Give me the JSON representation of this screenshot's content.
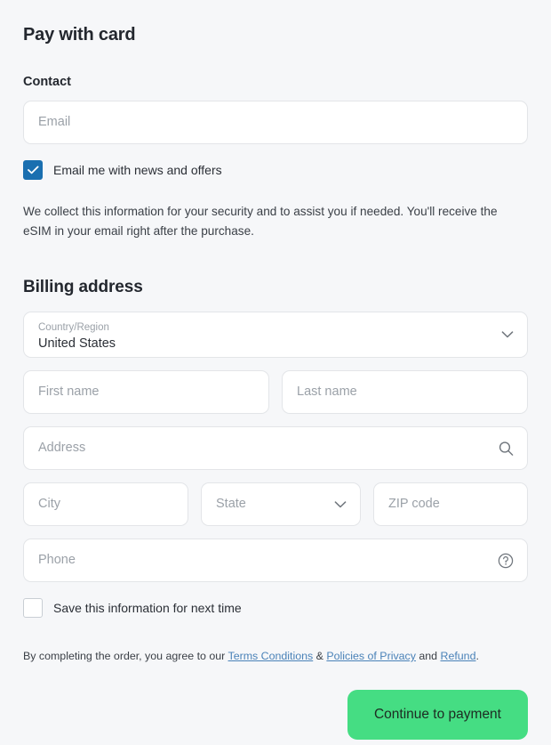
{
  "page": {
    "title": "Pay with card"
  },
  "contact": {
    "section_title": "Contact",
    "email": {
      "placeholder": "Email",
      "value": ""
    },
    "newsletter": {
      "label": "Email me with news and offers",
      "checked": true,
      "icon": "checkmark-icon"
    },
    "note": "We collect this information for your security and to assist you if needed. You'll receive the eSIM in your email right after the purchase."
  },
  "billing": {
    "section_title": "Billing address",
    "country": {
      "label": "Country/Region",
      "value": "United States",
      "icon": "chevron-down-icon"
    },
    "first_name": {
      "placeholder": "First name",
      "value": ""
    },
    "last_name": {
      "placeholder": "Last name",
      "value": ""
    },
    "address": {
      "placeholder": "Address",
      "value": "",
      "icon": "search-icon"
    },
    "city": {
      "placeholder": "City",
      "value": ""
    },
    "state": {
      "placeholder": "State",
      "value": "",
      "icon": "chevron-down-icon"
    },
    "zip": {
      "placeholder": "ZIP code",
      "value": ""
    },
    "phone": {
      "placeholder": "Phone",
      "value": "",
      "icon": "help-circle-icon"
    },
    "save_info": {
      "label": "Save this information for next time",
      "checked": false
    }
  },
  "legal": {
    "prefix": "By completing the order, you agree to our ",
    "terms_link": "Terms Conditions",
    "separator": " & ",
    "privacy_link": "Policies of Privacy",
    "conjunction": " and ",
    "refund_link": "Refund",
    "suffix": "."
  },
  "actions": {
    "submit_label": "Continue to payment"
  },
  "colors": {
    "page_background": "#f6f7f9",
    "field_background": "#ffffff",
    "field_border": "#e3e5e8",
    "checkbox_checked": "#1a6fb0",
    "link": "#4a82b8",
    "primary_button": "#45dd83",
    "text": "#2b2f36",
    "placeholder": "#9ba1a8"
  }
}
